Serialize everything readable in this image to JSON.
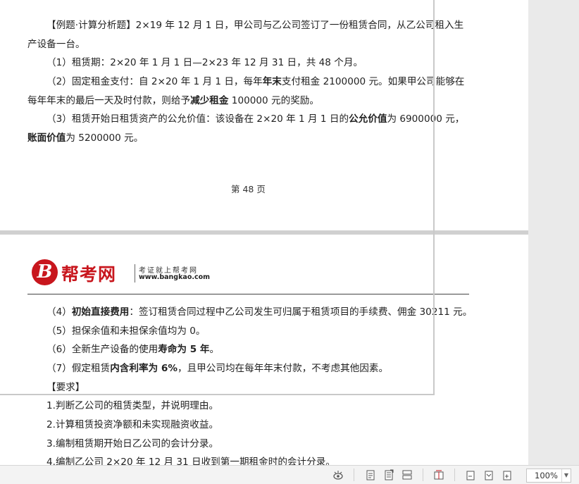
{
  "page1": {
    "example_line1": "【例题·计算分析题】2×19 年 12 月 1 日，甲公司与乙公司签订了一份租赁合同，从乙公司租入生",
    "example_line2": "产设备一台。",
    "item1": "（1）租赁期：2×20 年 1 月 1 日—2×23 年 12 月 31 日，共 48 个月。",
    "item2_a": "（2）固定租金支付：自 2×20 年 1 月 1 日，每年",
    "item2_b": "年末",
    "item2_c": "支付租金 2100000 元。如果甲公司能够在",
    "item2_d": "每年年末的最后一天及时付款，则给予",
    "item2_e": "减少租金",
    "item2_f": " 100000 元的奖励。",
    "item3_a": "（3）租赁开始日租赁资产的公允价值：该设备在 2×20 年 1 月 1 日的",
    "item3_b": "公允价值",
    "item3_c": "为 6900000 元，",
    "item3_d": "账面价值",
    "item3_e": "为 5200000 元。",
    "page_number": "第 48 页"
  },
  "page2": {
    "logo_letter": "B",
    "logo_name": "帮考网",
    "logo_slogan": "考证就上帮考网",
    "logo_url": "www.bangkao.com",
    "item4_a": "（4）",
    "item4_b": "初始直接费用",
    "item4_c": "：签订租赁合同过程中乙公司发生可归属于租赁项目的手续费、佣金 30211 元。",
    "item5": "（5）担保余值和未担保余值均为 0。",
    "item6_a": "（6）全新生产设备的使用",
    "item6_b": "寿命为 5 年",
    "item6_c": "。",
    "item7_a": "（7）假定租赁",
    "item7_b": "内含利率为 6%",
    "item7_c": "，且甲公司均在每年年末付款，不考虑其他因素。",
    "requirements_label": "【要求】",
    "req1": "1.判断乙公司的租赁类型，并说明理由。",
    "req2": "2.计算租赁投资净额和未实现融资收益。",
    "req3": "3.编制租赁期开始日乙公司的会计分录。",
    "req4": "4.编制乙公司 2×20 年 12 月 31 日收到第一期租金时的会计分录。"
  },
  "statusbar": {
    "zoom": "100%",
    "icons": [
      "eye-protect-icon",
      "page-view-icon",
      "full-page-icon",
      "web-layout-icon",
      "reading-mode-icon",
      "zoom-out-icon",
      "zoom-fit-icon",
      "zoom-in-icon"
    ]
  },
  "colors": {
    "brand_red": "#c8161d"
  }
}
